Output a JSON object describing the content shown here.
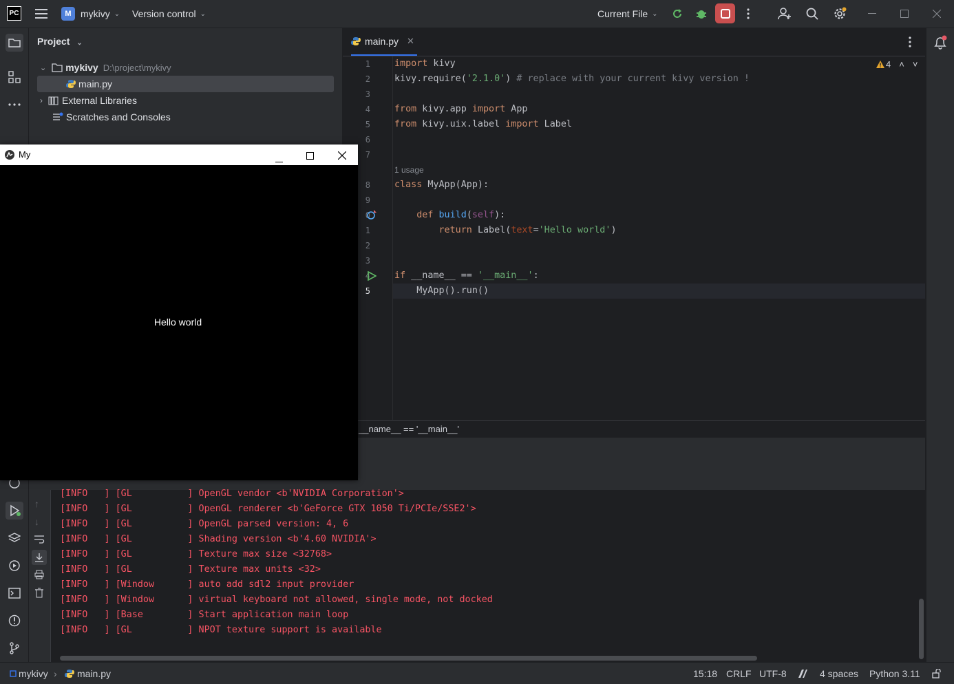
{
  "titlebar": {
    "logo": "PC",
    "project_badge": "M",
    "project_name": "mykivy",
    "vcs": "Version control",
    "run_config": "Current File"
  },
  "project_panel": {
    "title": "Project",
    "tree": [
      {
        "label": "mykivy",
        "path": "D:\\project\\mykivy"
      },
      {
        "label": "main.py"
      },
      {
        "label": "External Libraries"
      },
      {
        "label": "Scratches and Consoles"
      }
    ]
  },
  "editor": {
    "tab": "main.py",
    "warnings": "4",
    "usage_hint": "1 usage",
    "line_numbers": [
      "1",
      "2",
      "3",
      "4",
      "5",
      "6",
      "7",
      "8",
      "9",
      "0",
      "1",
      "2",
      "3",
      "4",
      "5"
    ],
    "breadcrumb": "__name__ == '__main__'",
    "lines": {
      "l1a": "import",
      "l1b": " kivy",
      "l2a": "kivy.require(",
      "l2b": "'2.1.0'",
      "l2c": ") ",
      "l2d": "# replace with your current kivy version !",
      "l4a": "from",
      "l4b": " kivy.app ",
      "l4c": "import",
      "l4d": " App",
      "l5a": "from",
      "l5b": " kivy.uix.label ",
      "l5c": "import",
      "l5d": " Label",
      "l8a": "class",
      "l8b": " MyApp(App):",
      "l10a": "    def ",
      "l10b": "build",
      "l10c": "(",
      "l10d": "self",
      "l10e": "):",
      "l11a": "        return ",
      "l11b": "Label(",
      "l11c": "text",
      "l11d": "=",
      "l11e": "'Hello world'",
      "l11f": ")",
      "l14a": "if",
      "l14b": " __name__ == ",
      "l14c": "'__main__'",
      "l14d": ":",
      "l15a": "    MyApp().run()"
    }
  },
  "console": {
    "lines": [
      "[INFO   ] [GL          ] OpenGL vendor <b'NVIDIA Corporation'>",
      "[INFO   ] [GL          ] OpenGL renderer <b'GeForce GTX 1050 Ti/PCIe/SSE2'>",
      "[INFO   ] [GL          ] OpenGL parsed version: 4, 6",
      "[INFO   ] [GL          ] Shading version <b'4.60 NVIDIA'>",
      "[INFO   ] [GL          ] Texture max size <32768>",
      "[INFO   ] [GL          ] Texture max units <32>",
      "[INFO   ] [Window      ] auto add sdl2 input provider",
      "[INFO   ] [Window      ] virtual keyboard not allowed, single mode, not docked",
      "[INFO   ] [Base        ] Start application main loop",
      "[INFO   ] [GL          ] NPOT texture support is available"
    ]
  },
  "statusbar": {
    "project": "mykivy",
    "file": "main.py",
    "position": "15:18",
    "line_sep": "CRLF",
    "encoding": "UTF-8",
    "indent": "4 spaces",
    "interpreter": "Python 3.11"
  },
  "kivy_window": {
    "title": "My",
    "label": "Hello world"
  },
  "colors": {
    "accent": "#3574f0",
    "stop_button": "#e06c75",
    "console_text": "#f75464"
  }
}
